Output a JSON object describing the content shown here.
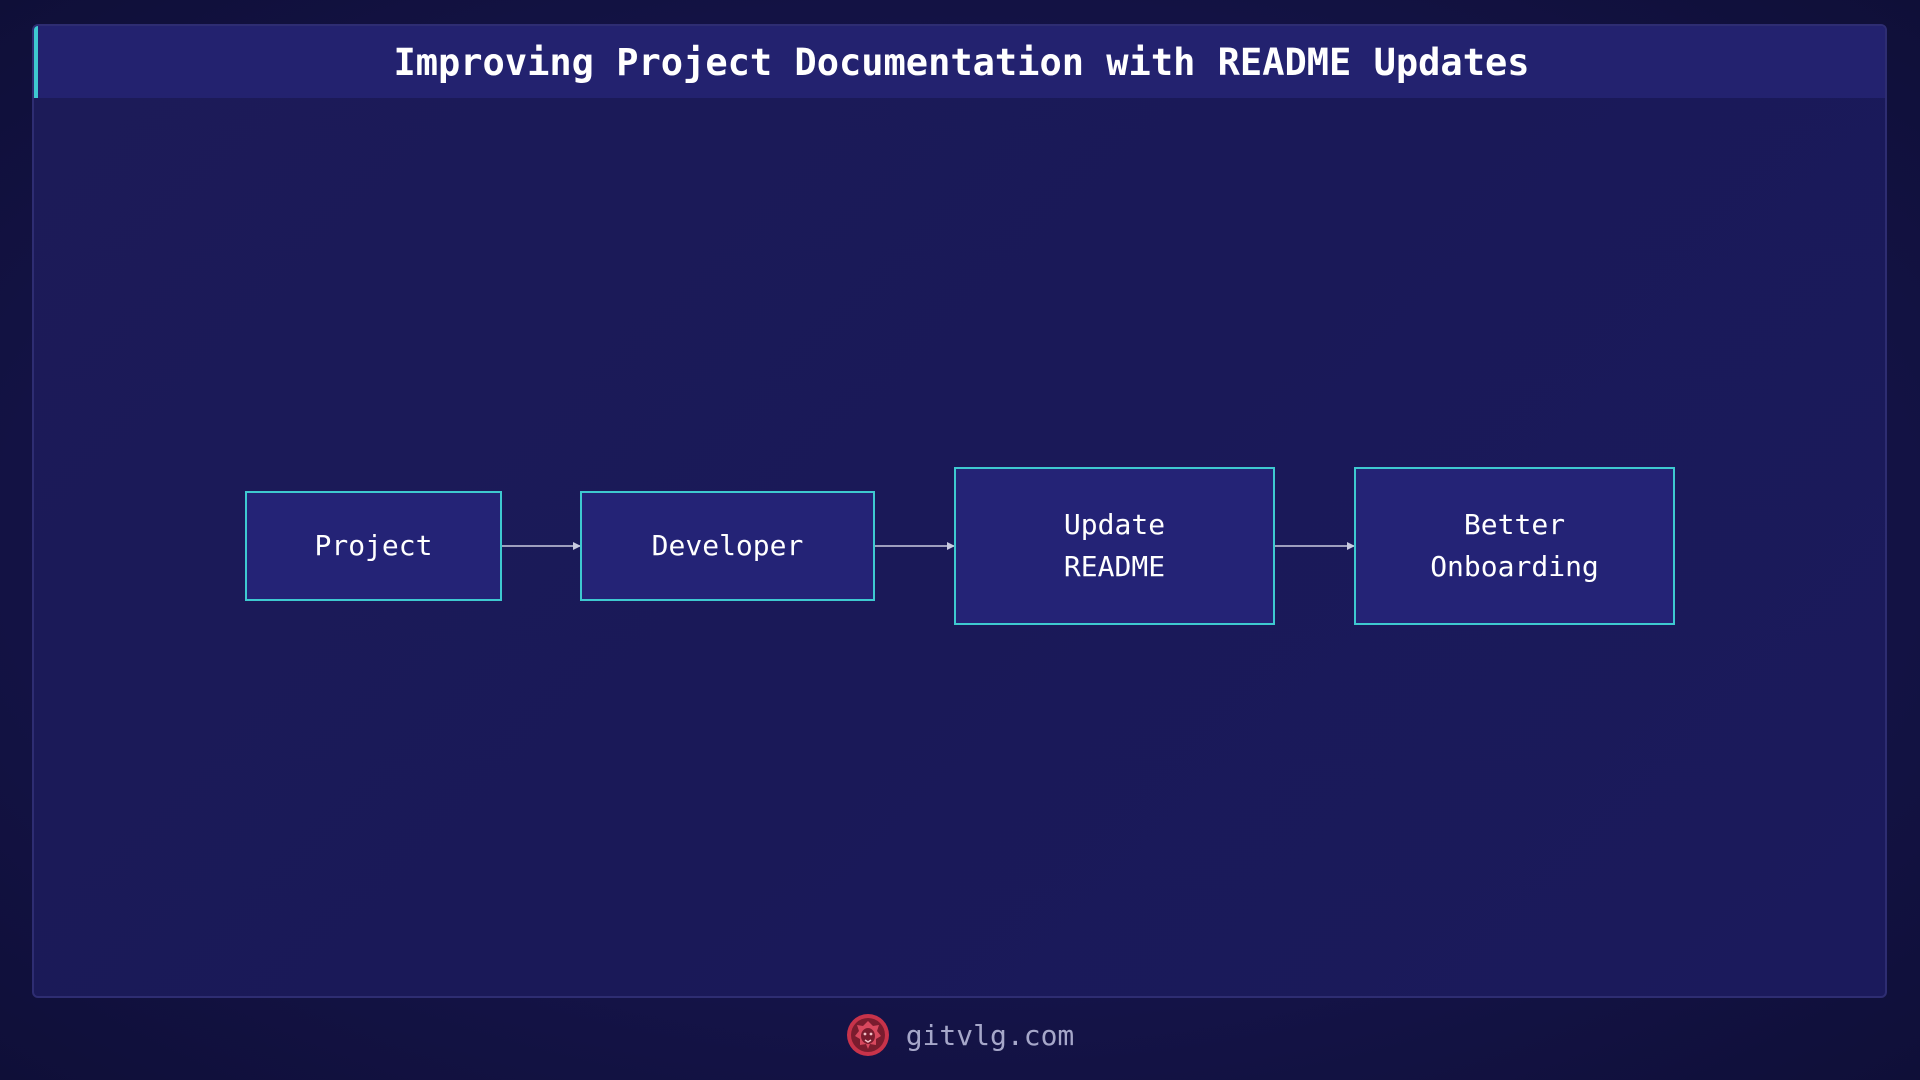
{
  "header": {
    "title": "Improving Project Documentation with README Updates"
  },
  "diagram": {
    "nodes": [
      {
        "id": "project",
        "label": "Project"
      },
      {
        "id": "developer",
        "label": "Developer"
      },
      {
        "id": "update-readme",
        "label": "Update\nREADME"
      },
      {
        "id": "better-onboarding",
        "label": "Better\nOnboarding"
      }
    ],
    "edges": [
      {
        "from": "project",
        "to": "developer"
      },
      {
        "from": "developer",
        "to": "update-readme"
      },
      {
        "from": "update-readme",
        "to": "better-onboarding"
      }
    ]
  },
  "footer": {
    "site": "gitvlg.com",
    "logo_icon": "lion-head-icon"
  },
  "colors": {
    "background": "#15144a",
    "panel": "#1b1a5a",
    "title_bar": "#23226f",
    "accent": "#3ec9d0",
    "node_fill": "#242376",
    "logo": "#c8334a"
  }
}
